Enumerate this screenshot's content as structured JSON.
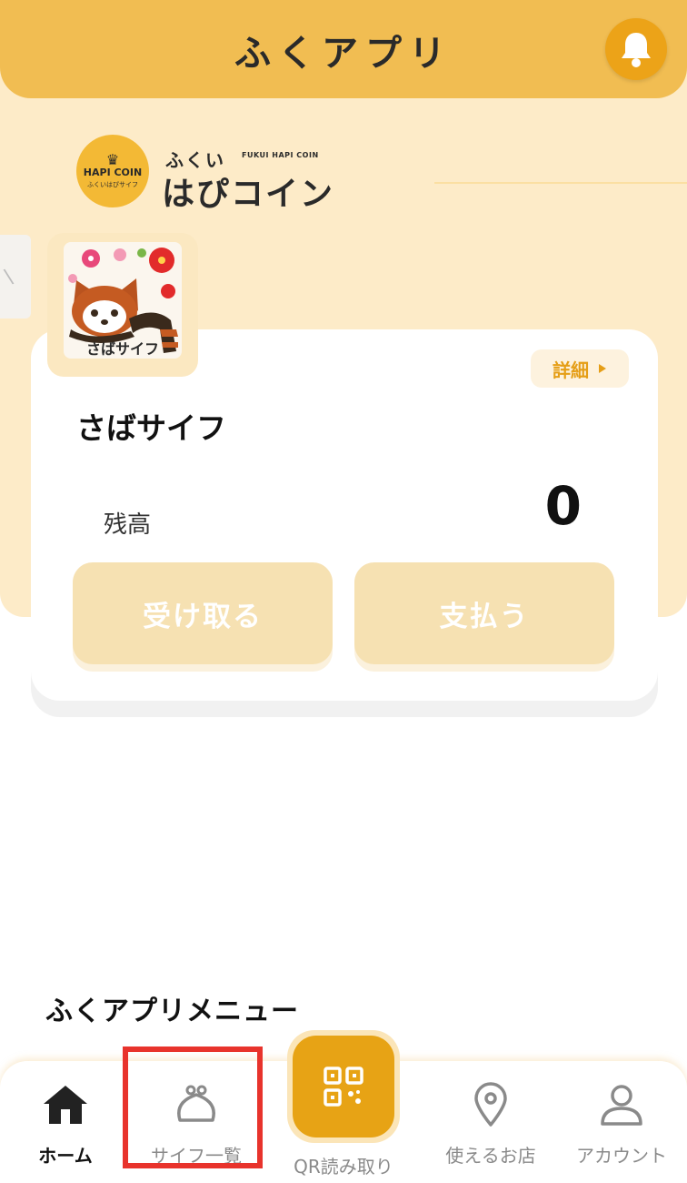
{
  "header": {
    "title": "ふくアプリ",
    "notification_icon": "bell-icon"
  },
  "brand": {
    "coin_badge_name": "HAPI COIN",
    "coin_badge_sub": "ふくいはぴサイフ",
    "title_small": "ふくい",
    "title_en": "FUKUI HAPI COIN",
    "title_big": "はぴコイン"
  },
  "wallet": {
    "thumb_label": "さばサイフ",
    "name": "さばサイフ",
    "detail_label": "詳細",
    "balance_label": "残高",
    "balance_value": "0",
    "receive_label": "受け取る",
    "pay_label": "支払う"
  },
  "menu_title": "ふくアプリメニュー",
  "bottom_nav": {
    "home": "ホーム",
    "wallets": "サイフ一覧",
    "qr": "QR読み取り",
    "stores": "使えるお店",
    "account": "アカウント"
  },
  "colors": {
    "header": "#f1bd52",
    "accent": "#e7a315",
    "cream": "#fdebc8",
    "highlight": "#e8332c"
  }
}
